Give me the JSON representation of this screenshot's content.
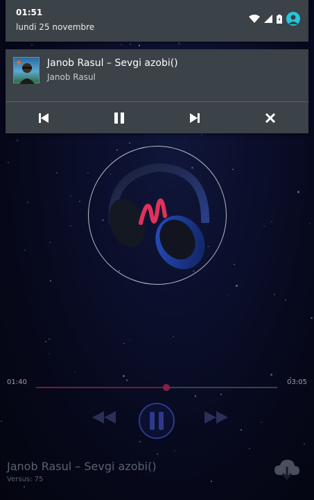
{
  "status_shade": {
    "time": "01:51",
    "date": "lundi 25 novembre"
  },
  "notification": {
    "title": "Janob Rasul – Sevgi azobi()",
    "artist": "Janob Rasul",
    "controls": [
      "skip-previous-icon",
      "pause-icon",
      "skip-next-icon",
      "close-icon"
    ]
  },
  "player": {
    "elapsed": "01:40",
    "duration": "03:05",
    "progress_fraction": 0.54,
    "track_title": "Janob Rasul – Sevgi azobi()",
    "version_label": "Versus: 75"
  },
  "colors": {
    "shade_bg": "#3b4248",
    "accent": "#8b1e44",
    "status_avatar": "#26c6da"
  }
}
